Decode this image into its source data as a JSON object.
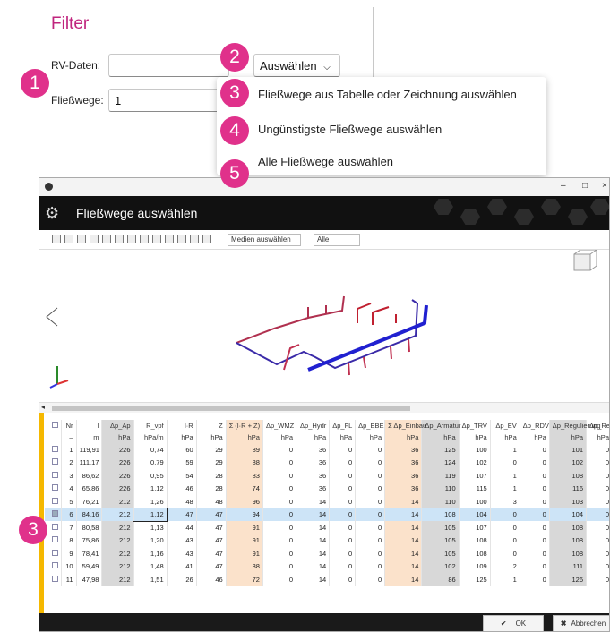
{
  "filter": {
    "title": "Filter",
    "rv_label": "RV-Daten:",
    "rv_value": "",
    "dropdown_label": "Auswählen",
    "fw_label": "Fließwege:",
    "fw_value": "1"
  },
  "badges": [
    "1",
    "2",
    "3",
    "4",
    "5",
    "3"
  ],
  "menu": [
    "Fließwege aus Tabelle oder Zeichnung auswählen",
    "Ungünstigste Fließwege auswählen",
    "Alle Fließwege auswählen"
  ],
  "window": {
    "title": "Fließwege auswählen",
    "minimize": "–",
    "maximize": "□",
    "close": "×"
  },
  "toolbar": {
    "medien": "Medien auswählen",
    "alle": "Alle"
  },
  "table": {
    "headers": [
      [
        "",
        "Nr",
        "l",
        "Δp_Ap",
        "R_vpf",
        "l·R",
        "Z",
        "Σ (l·R + Z)",
        "Δp_WMZ",
        "Δp_Hydr",
        "Δp_FL",
        "Δp_EBE",
        "Σ Δp_Einbau",
        "Δp_Armatur",
        "Δp_TRV",
        "Δp_EV",
        "Δp_RDV",
        "Δp_Regulierung",
        "Δp_Rest"
      ],
      [
        "",
        "–",
        "m",
        "hPa",
        "hPa/m",
        "hPa",
        "hPa",
        "hPa",
        "hPa",
        "hPa",
        "hPa",
        "hPa",
        "hPa",
        "hPa",
        "hPa",
        "hPa",
        "hPa",
        "hPa",
        "hPa"
      ]
    ],
    "rows": [
      [
        "1",
        "119,91",
        "226",
        "0,74",
        "60",
        "29",
        "89",
        "0",
        "36",
        "0",
        "0",
        "36",
        "125",
        "100",
        "1",
        "0",
        "101",
        "0"
      ],
      [
        "2",
        "111,17",
        "226",
        "0,79",
        "59",
        "29",
        "88",
        "0",
        "36",
        "0",
        "0",
        "36",
        "124",
        "102",
        "0",
        "0",
        "102",
        "0"
      ],
      [
        "3",
        "86,62",
        "226",
        "0,95",
        "54",
        "28",
        "83",
        "0",
        "36",
        "0",
        "0",
        "36",
        "119",
        "107",
        "1",
        "0",
        "108",
        "0"
      ],
      [
        "4",
        "65,86",
        "226",
        "1,12",
        "46",
        "28",
        "74",
        "0",
        "36",
        "0",
        "0",
        "36",
        "110",
        "115",
        "1",
        "0",
        "116",
        "0"
      ],
      [
        "5",
        "76,21",
        "212",
        "1,26",
        "48",
        "48",
        "96",
        "0",
        "14",
        "0",
        "0",
        "14",
        "110",
        "100",
        "3",
        "0",
        "103",
        "0"
      ],
      [
        "6",
        "84,16",
        "212",
        "1,12",
        "47",
        "47",
        "94",
        "0",
        "14",
        "0",
        "0",
        "14",
        "108",
        "104",
        "0",
        "0",
        "104",
        "0"
      ],
      [
        "7",
        "80,58",
        "212",
        "1,13",
        "44",
        "47",
        "91",
        "0",
        "14",
        "0",
        "0",
        "14",
        "105",
        "107",
        "0",
        "0",
        "108",
        "0"
      ],
      [
        "8",
        "75,86",
        "212",
        "1,20",
        "43",
        "47",
        "91",
        "0",
        "14",
        "0",
        "0",
        "14",
        "105",
        "108",
        "0",
        "0",
        "108",
        "0"
      ],
      [
        "9",
        "78,41",
        "212",
        "1,16",
        "43",
        "47",
        "91",
        "0",
        "14",
        "0",
        "0",
        "14",
        "105",
        "108",
        "0",
        "0",
        "108",
        "0"
      ],
      [
        "10",
        "59,49",
        "212",
        "1,48",
        "41",
        "47",
        "88",
        "0",
        "14",
        "0",
        "0",
        "14",
        "102",
        "109",
        "2",
        "0",
        "111",
        "0"
      ],
      [
        "11",
        "47,98",
        "212",
        "1,51",
        "26",
        "46",
        "72",
        "0",
        "14",
        "0",
        "0",
        "14",
        "86",
        "125",
        "1",
        "0",
        "126",
        "0"
      ]
    ],
    "selected_row": 5
  },
  "footer": {
    "ok": "OK",
    "cancel": "Abbrechen"
  },
  "colors": {
    "accent": "#e0318b",
    "title": "#c0257e",
    "selected": "#cde4f7",
    "orange_col": "#fbe2cb"
  }
}
